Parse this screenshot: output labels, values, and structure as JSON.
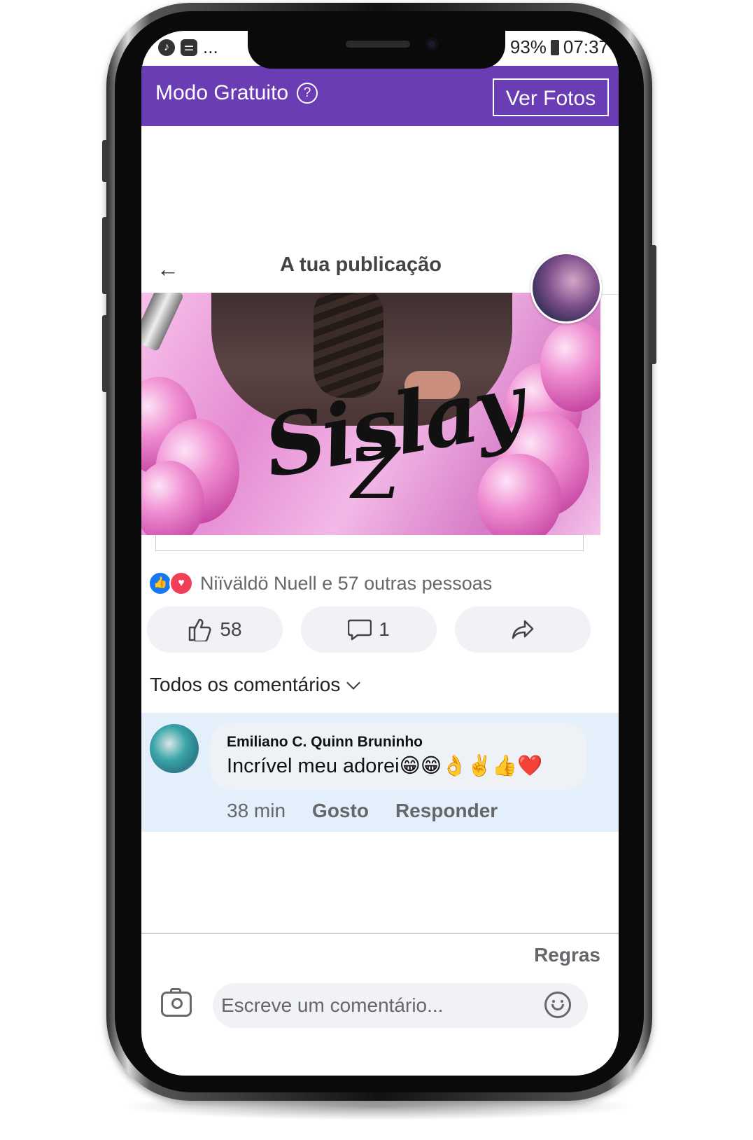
{
  "status_bar": {
    "left_more": "...",
    "battery": "93%",
    "time": "07:37"
  },
  "top_bar": {
    "mode_label": "Modo Gratuito",
    "help_icon": "?",
    "view_photos_label": "Ver Fotos",
    "accent_color": "#6a3db5"
  },
  "post": {
    "header_title": "A tua publicação",
    "image_text_main": "Sislay",
    "image_text_sub": "Z"
  },
  "reactions": {
    "summary": "Niïväldö Nuell e 57 outras pessoas",
    "like_count": "58",
    "comment_count": "1"
  },
  "comments": {
    "filter_label": "Todos os comentários",
    "items": [
      {
        "author": "Emiliano C. Quinn Bruninho",
        "text": "Incrível meu adorei😁😁👌✌️👍❤️",
        "time": "38 min",
        "like_label": "Gosto",
        "reply_label": "Responder"
      }
    ]
  },
  "footer": {
    "rules_label": "Regras",
    "input_placeholder": "Escreve um comentário..."
  }
}
